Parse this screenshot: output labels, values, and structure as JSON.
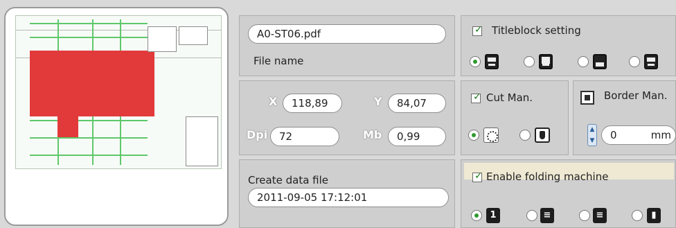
{
  "file": {
    "name_value": "A0-ST06.pdf",
    "name_label": "File name"
  },
  "coords": {
    "x_label": "X",
    "x_value": "118,89",
    "y_label": "Y",
    "y_value": "84,07",
    "dpi_label": "Dpi",
    "dpi_value": "72",
    "mb_label": "Mb",
    "mb_value": "0,99"
  },
  "datafile": {
    "label": "Create data file",
    "value": "2011-09-05 17:12:01"
  },
  "titleblock": {
    "label": "Titleblock setting",
    "checked": true
  },
  "cut": {
    "label": "Cut Man.",
    "checked": true
  },
  "border": {
    "label": "Border Man.",
    "value": "0",
    "unit": "mm"
  },
  "folding": {
    "label": "Enable folding machine",
    "checked": true
  },
  "icons": {
    "titleblock_options": [
      "titleblock-icon-1",
      "titleblock-icon-2",
      "titleblock-icon-3",
      "titleblock-icon-4"
    ],
    "cut_options": [
      "cut-auto-icon",
      "cut-manual-hand-icon"
    ],
    "fold_options": [
      "fold-icon-1",
      "fold-icon-2",
      "fold-icon-3",
      "fold-icon-4"
    ]
  },
  "colors": {
    "background": "#d9d9d9",
    "check_green": "#1a7a1a",
    "drawing_red": "#e23a3a"
  }
}
